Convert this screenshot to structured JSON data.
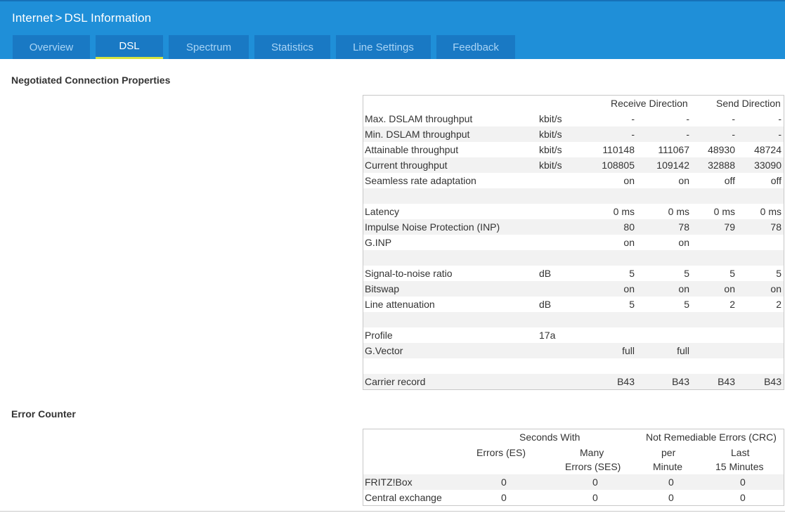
{
  "breadcrumb": {
    "parent": "Internet",
    "separator": ">",
    "current": "DSL Information"
  },
  "tabs": [
    {
      "label": "Overview",
      "active": false
    },
    {
      "label": "DSL",
      "active": true
    },
    {
      "label": "Spectrum",
      "active": false
    },
    {
      "label": "Statistics",
      "active": false
    },
    {
      "label": "Line Settings",
      "active": false
    },
    {
      "label": "Feedback",
      "active": false
    }
  ],
  "connection": {
    "heading": "Negotiated Connection Properties",
    "receive_header": "Receive Direction",
    "send_header": "Send Direction",
    "rows": [
      {
        "label": "Max. DSLAM throughput",
        "unit": "kbit/s",
        "values": [
          "-",
          "-",
          "-",
          "-"
        ]
      },
      {
        "label": "Min. DSLAM throughput",
        "unit": "kbit/s",
        "values": [
          "-",
          "-",
          "-",
          "-"
        ]
      },
      {
        "label": "Attainable throughput",
        "unit": "kbit/s",
        "values": [
          "110148",
          "111067",
          "48930",
          "48724"
        ]
      },
      {
        "label": "Current throughput",
        "unit": "kbit/s",
        "values": [
          "108805",
          "109142",
          "32888",
          "33090"
        ]
      },
      {
        "label": "Seamless rate adaptation",
        "unit": "",
        "values": [
          "on",
          "on",
          "off",
          "off"
        ]
      },
      {
        "label": "",
        "unit": "",
        "values": [
          "",
          "",
          "",
          ""
        ]
      },
      {
        "label": "Latency",
        "unit": "",
        "values": [
          "0 ms",
          "0 ms",
          "0 ms",
          "0 ms"
        ]
      },
      {
        "label": "Impulse Noise Protection (INP)",
        "unit": "",
        "values": [
          "80",
          "78",
          "79",
          "78"
        ]
      },
      {
        "label": "G.INP",
        "unit": "",
        "values": [
          "on",
          "on",
          "",
          ""
        ]
      },
      {
        "label": "",
        "unit": "",
        "values": [
          "",
          "",
          "",
          ""
        ]
      },
      {
        "label": "Signal-to-noise ratio",
        "unit": "dB",
        "values": [
          "5",
          "5",
          "5",
          "5"
        ]
      },
      {
        "label": "Bitswap",
        "unit": "",
        "values": [
          "on",
          "on",
          "on",
          "on"
        ]
      },
      {
        "label": "Line attenuation",
        "unit": "dB",
        "values": [
          "5",
          "5",
          "2",
          "2"
        ]
      },
      {
        "label": "",
        "unit": "",
        "values": [
          "",
          "",
          "",
          ""
        ]
      },
      {
        "label": "Profile",
        "unit": "17a",
        "values": [
          "",
          "",
          "",
          ""
        ]
      },
      {
        "label": "G.Vector",
        "unit": "",
        "values": [
          "full",
          "full",
          "",
          ""
        ]
      },
      {
        "label": "",
        "unit": "",
        "values": [
          "",
          "",
          "",
          ""
        ]
      },
      {
        "label": "Carrier record",
        "unit": "",
        "values": [
          "B43",
          "B43",
          "B43",
          "B43"
        ]
      }
    ]
  },
  "errors": {
    "heading": "Error Counter",
    "group_seconds": "Seconds With",
    "group_crc": "Not Remediable Errors (CRC)",
    "col_es": "Errors (ES)",
    "col_ses_1": "Many",
    "col_ses_2": "Errors (SES)",
    "col_min_1": "per",
    "col_min_2": "Minute",
    "col_15_1": "Last",
    "col_15_2": "15 Minutes",
    "rows": [
      {
        "label": "FRITZ!Box",
        "values": [
          "0",
          "0",
          "0",
          "0"
        ]
      },
      {
        "label": "Central exchange",
        "values": [
          "0",
          "0",
          "0",
          "0"
        ]
      }
    ]
  }
}
